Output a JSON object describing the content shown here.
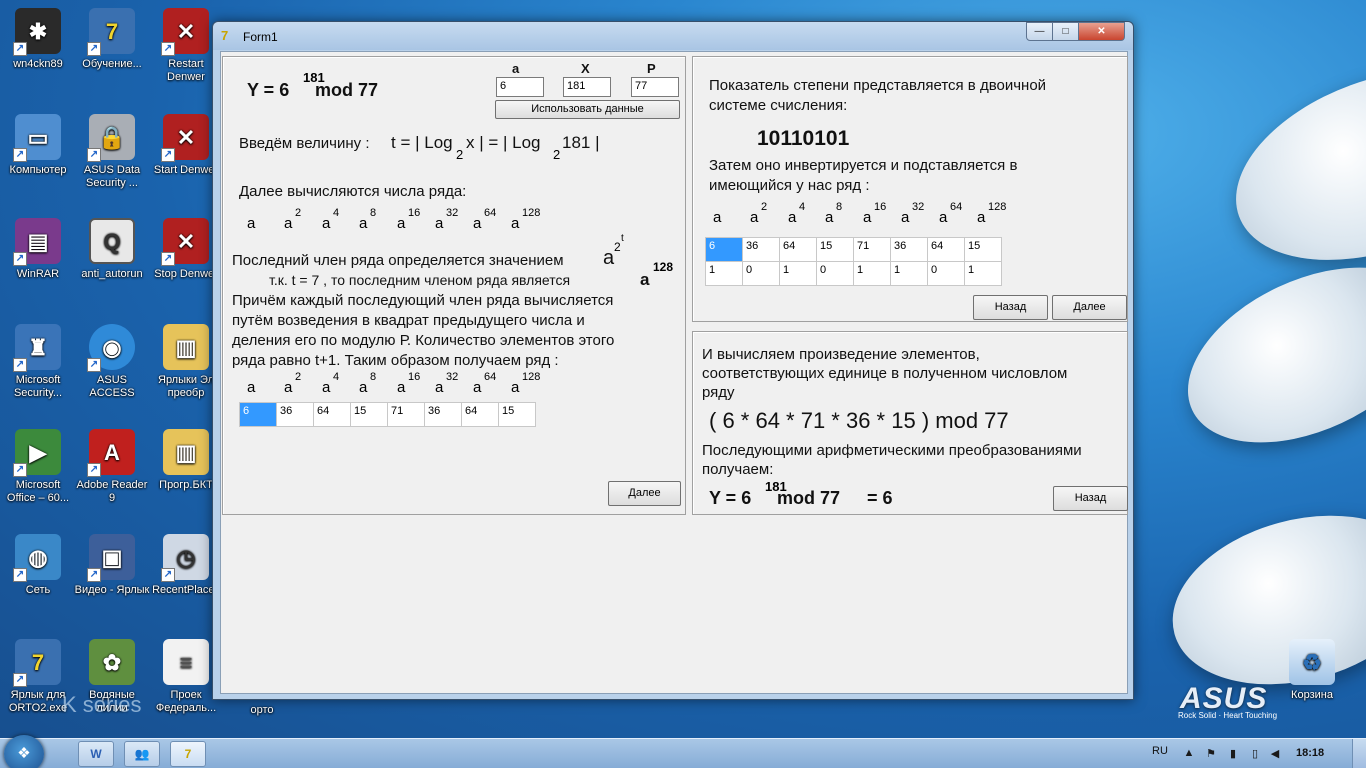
{
  "desktop": {
    "icons": [
      {
        "label": "wn4ckn89",
        "icon": "spider-icon",
        "color": "#2a2a2a"
      },
      {
        "label": "Обучение...",
        "icon": "seven-bolt-icon",
        "color": "#d8c02a"
      },
      {
        "label": "Restart Denwer",
        "icon": "denwer-icon",
        "color": "#b02020"
      },
      {
        "label": "Компьютер",
        "icon": "computer-icon",
        "color": "#4f8ed0"
      },
      {
        "label": "ASUS Data Security ...",
        "icon": "lock-icon",
        "color": "#a9aeb5"
      },
      {
        "label": "Start Denwer",
        "icon": "denwer-icon",
        "color": "#b02020"
      },
      {
        "label": "WinRAR",
        "icon": "archive-icon",
        "color": "#7a3a8c"
      },
      {
        "label": "anti_autorun",
        "icon": "q-icon",
        "color": "#e8e8e8"
      },
      {
        "label": "Stop Denwer",
        "icon": "denwer-icon",
        "color": "#b02020"
      },
      {
        "label": "Microsoft Security...",
        "icon": "castle-icon",
        "color": "#3a74b8"
      },
      {
        "label": "ASUS ACCESS",
        "icon": "globe-icon",
        "color": "#2f8ad8"
      },
      {
        "label": "Ярлыки Эл преобр",
        "icon": "folder-icon",
        "color": "#e6c35a"
      },
      {
        "label": "Microsoft Office – 60...",
        "icon": "office-icon",
        "color": "#3c8a3c"
      },
      {
        "label": "Adobe Reader 9",
        "icon": "pdf-icon",
        "color": "#c0201e"
      },
      {
        "label": "Прогр.БКТ",
        "icon": "folder-icon",
        "color": "#e6c35a"
      },
      {
        "label": "Сеть",
        "icon": "network-icon",
        "color": "#3a88c8"
      },
      {
        "label": "Видео - Ярлык",
        "icon": "video-icon",
        "color": "#3d5f9a"
      },
      {
        "label": "RecentPlaces",
        "icon": "recent-icon",
        "color": "#cfd8e4"
      },
      {
        "label": "Ярлык для ORTO2.exe",
        "icon": "seven-bolt-icon",
        "color": "#d8c02a"
      },
      {
        "label": "Водяные лилии",
        "icon": "image-icon",
        "color": "#5f8f3f"
      },
      {
        "label": "Проек Федераль...",
        "icon": "document-icon",
        "color": "#f2f2f2"
      },
      {
        "label": "орто",
        "icon": "folder-icon",
        "color": "#e6c35a"
      }
    ],
    "recycle_bin": "Корзина",
    "asus_logo": "ASUS",
    "asus_tagline": "Rock Solid · Heart Touching",
    "kseries": "K series"
  },
  "window": {
    "title": "Form1",
    "controls": {
      "minimize": "—",
      "maximize": "□",
      "close": "✕"
    }
  },
  "left_panel": {
    "formula": {
      "y_label": "Y = 6",
      "exponent": "181",
      "mod": "mod 77"
    },
    "inputs": {
      "a_label": "a",
      "a_value": "6",
      "x_label": "X",
      "x_value": "181",
      "p_label": "P",
      "p_value": "77"
    },
    "use_data_button": "Использовать данные",
    "enter_value_text": "Введём величину :",
    "t_formula": {
      "part1": "t = | Log",
      "sub1": "2",
      "part2": "x |  = | Log",
      "sub2": "2",
      "part3": "181 |"
    },
    "series_intro": "Далее вычисляются числа ряда:",
    "series_base": "a",
    "series_exponents": [
      "",
      "2",
      "4",
      "8",
      "16",
      "32",
      "64",
      "128"
    ],
    "last_member_line": "Последний член ряда определяется значением",
    "last_member_power": "a",
    "last_member_exp1": "2",
    "last_member_exp2": "t",
    "since_line": "т.к.  t = 7  , то  последним членом ряда является",
    "since_power": "a",
    "since_exp": "128",
    "paragraph": [
      "Причём каждый последующий член ряда вычисляется",
      "путём возведения в квадрат предыдущего числа и",
      "деления его по модулю Р. Количество элементов этого",
      "ряда равно t+1. Таким образом получаем ряд :"
    ],
    "row_values": [
      "6",
      "36",
      "64",
      "15",
      "71",
      "36",
      "64",
      "15"
    ],
    "next_button": "Далее"
  },
  "right_top_panel": {
    "binary_intro": [
      "Показатель степени представляется в двоичной",
      "системе счисления:"
    ],
    "binary_value": "10110101",
    "invert_text": [
      "Затем оно инвертируется  и подставляется в",
      "имеющийся у нас ряд :"
    ],
    "series_base": "a",
    "series_exponents": [
      "",
      "2",
      "4",
      "8",
      "16",
      "32",
      "64",
      "128"
    ],
    "row_values": [
      "6",
      "36",
      "64",
      "15",
      "71",
      "36",
      "64",
      "15"
    ],
    "bits": [
      "1",
      "0",
      "1",
      "0",
      "1",
      "1",
      "0",
      "1"
    ],
    "back_button": "Назад",
    "next_button": "Далее"
  },
  "right_bottom_panel": {
    "compute_text": [
      "И вычисляем произведение элементов,",
      "соответствующих единице в полученном числовлом",
      "ряду"
    ],
    "product_formula": "( 6 * 64 * 71 * 36 * 15 ) mod 77",
    "transform_text": [
      "Последующими арифметическими преобразованиями",
      "получаем:"
    ],
    "result": {
      "y_label": "Y = 6",
      "exponent": "181",
      "mod": "mod 77",
      "equals": "= 6"
    },
    "back_button": "Назад"
  },
  "taskbar": {
    "items": [
      {
        "label": "W",
        "icon": "word-icon"
      },
      {
        "label": "👥",
        "icon": "users-icon"
      },
      {
        "label": "7",
        "icon": "seven-bolt-icon"
      }
    ],
    "language": "RU",
    "clock": "18:18"
  }
}
